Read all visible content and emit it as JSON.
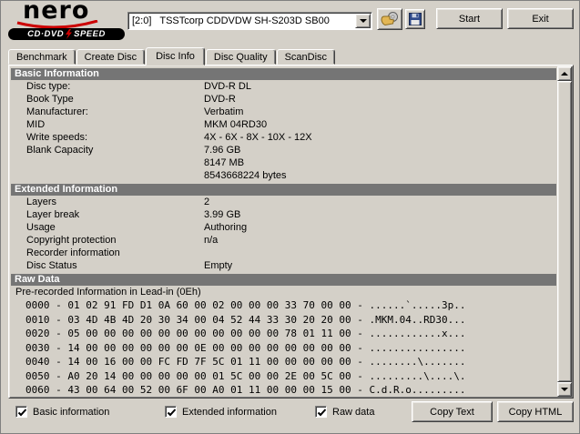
{
  "header": {
    "logo": {
      "brand": "nero",
      "product_left": "CD·DVD",
      "product_right": "SPEED"
    },
    "drive_select": {
      "value": "[2:0]   TSSTcorp CDDVDW SH-S203D SB00"
    },
    "start_label": "Start",
    "exit_label": "Exit"
  },
  "tabs": [
    {
      "label": "Benchmark",
      "selected": false
    },
    {
      "label": "Create Disc",
      "selected": false
    },
    {
      "label": "Disc Info",
      "selected": true
    },
    {
      "label": "Disc Quality",
      "selected": false
    },
    {
      "label": "ScanDisc",
      "selected": false
    }
  ],
  "basic": {
    "title": "Basic Information",
    "rows": [
      {
        "label": "Disc type:",
        "value": "DVD-R DL"
      },
      {
        "label": "Book Type",
        "value": "DVD-R"
      },
      {
        "label": "Manufacturer:",
        "value": "Verbatim"
      },
      {
        "label": "MID",
        "value": "MKM 04RD30"
      },
      {
        "label": "Write speeds:",
        "value": "4X - 6X - 8X - 10X - 12X"
      },
      {
        "label": "Blank Capacity",
        "value": "7.96 GB"
      },
      {
        "label": "",
        "value": "8147 MB"
      },
      {
        "label": "",
        "value": "8543668224 bytes"
      }
    ]
  },
  "extended": {
    "title": "Extended Information",
    "rows": [
      {
        "label": "Layers",
        "value": "2"
      },
      {
        "label": "Layer break",
        "value": "3.99 GB"
      },
      {
        "label": "Usage",
        "value": "Authoring"
      },
      {
        "label": "Copyright protection",
        "value": "n/a"
      },
      {
        "label": "Recorder information",
        "value": ""
      },
      {
        "label": "Disc Status",
        "value": "Empty"
      }
    ]
  },
  "raw": {
    "title": "Raw Data",
    "subtitle": "Pre-recorded Information in Lead-in (0Eh)",
    "lines": [
      "0000 - 01 02 91 FD D1 0A 60 00 02 00 00 00 33 70 00 00 - ......`.....3p..",
      "0010 - 03 4D 4B 4D 20 30 34 00 04 52 44 33 30 20 20 00 - .MKM.04..RD30...",
      "0020 - 05 00 00 00 00 00 00 00 00 00 00 00 78 01 11 00 - ............x...",
      "0030 - 14 00 00 00 00 00 00 0E 00 00 00 00 00 00 00 00 - ................",
      "0040 - 14 00 16 00 00 FC FD 7F 5C 01 11 00 00 00 00 00 - ........\\.......",
      "0050 - A0 20 14 00 00 00 00 00 01 5C 00 00 2E 00 5C 00 - .........\\....\\.",
      "0060 - 43 00 64 00 52 00 6F 00 A0 01 11 00 00 00 15 00 - C.d.R.o........."
    ]
  },
  "footer": {
    "checkboxes": [
      {
        "label": "Basic information",
        "checked": true
      },
      {
        "label": "Extended information",
        "checked": true
      },
      {
        "label": "Raw data",
        "checked": true
      }
    ],
    "copy_text_label": "Copy Text",
    "copy_html_label": "Copy HTML"
  },
  "colors": {
    "window_bg": "#d4d0c8",
    "section_header_bg": "#757575",
    "section_header_text": "#ffffff",
    "accent_red": "#cc0000"
  }
}
